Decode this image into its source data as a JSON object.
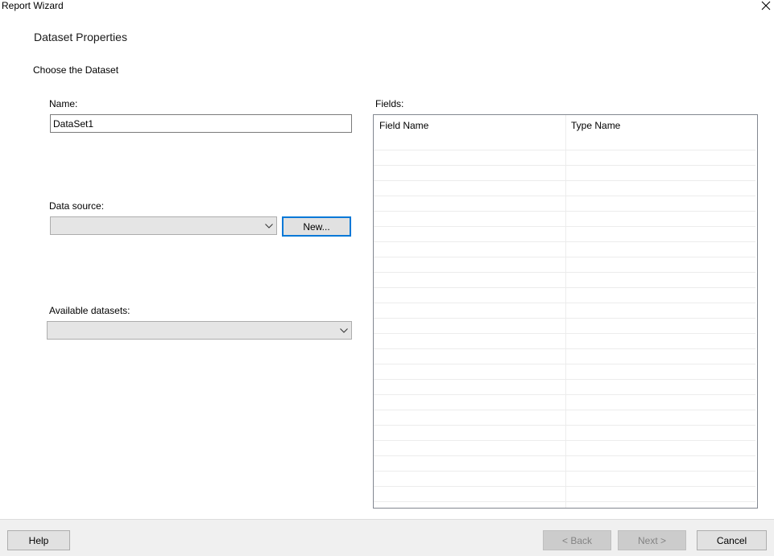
{
  "window": {
    "title": "Report Wizard",
    "close_icon": "close-icon"
  },
  "page": {
    "heading": "Dataset Properties",
    "subheading": "Choose the Dataset"
  },
  "name_field": {
    "label": "Name:",
    "value": "DataSet1"
  },
  "data_source": {
    "label": "Data source:",
    "selected": "",
    "new_button_label": "New..."
  },
  "available_datasets": {
    "label": "Available datasets:",
    "selected": ""
  },
  "fields": {
    "label": "Fields:",
    "columns": [
      "Field Name",
      "Type Name"
    ],
    "rows": []
  },
  "footer": {
    "help_label": "Help",
    "back_label": "< Back",
    "next_label": "Next >",
    "cancel_label": "Cancel"
  },
  "colors": {
    "focus_border": "#0078d7",
    "footer_background": "#f0f0f0",
    "disabled_button": "#cccccc"
  }
}
